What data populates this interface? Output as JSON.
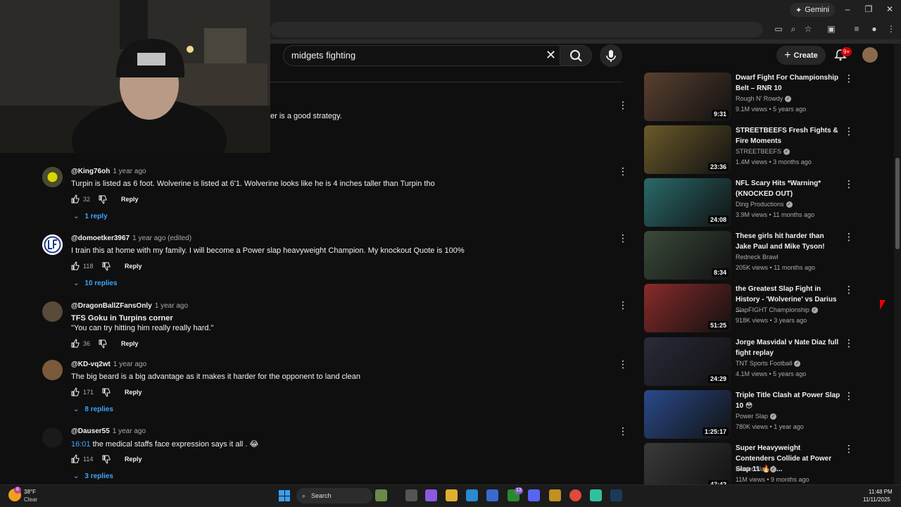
{
  "browser": {
    "gemini_label": "Gemini"
  },
  "search": {
    "query": "midgets fighting"
  },
  "header": {
    "create_label": "Create",
    "notification_count": "9+"
  },
  "partial_comment": {
    "text_fragment": "er is a good strategy."
  },
  "comments": [
    {
      "author": "@King76oh",
      "time": "1 year ago",
      "text": "Turpin is listed as 6 foot. Wolverine is listed at 6'1. Wolverine looks like he is 4 inches taller than Turpin tho",
      "likes": "32",
      "reply_label": "Reply",
      "replies": "1 reply"
    },
    {
      "author": "@domoetker3967",
      "time": "1 year ago (edited)",
      "text": "I train this at home with my family. I will become a Power slap heavyweight Champion. My knockout Quote is 100%",
      "likes": "118",
      "reply_label": "Reply",
      "replies": "10 replies"
    },
    {
      "author": "@DragonBallZFansOnly",
      "time": "1 year ago",
      "text_line1": "TFS Goku in Turpins corner",
      "text_line2": "\"You can try hitting him really really hard.\"",
      "likes": "36",
      "reply_label": "Reply"
    },
    {
      "author": "@KD-vq2wt",
      "time": "1 year ago",
      "text": "The big beard is a big advantage as it makes it harder for the opponent to land clean",
      "likes": "171",
      "reply_label": "Reply",
      "replies": "8 replies"
    },
    {
      "author": "@Dauser55",
      "time": "1 year ago",
      "timestamp": "16:01",
      "text": " the medical staffs face expression says it all . 😂",
      "likes": "114",
      "reply_label": "Reply",
      "replies": "3 replies"
    }
  ],
  "videos": [
    {
      "title": "Dwarf Fight For Championship Belt – RNR 10",
      "channel": "Rough N' Rowdy",
      "views": "9.1M views",
      "age": "5 years ago",
      "duration": "9:31",
      "color": "#5a4030"
    },
    {
      "title": "STREETBEEFS Fresh Fights & Fire Moments",
      "channel": "STREETBEEFS",
      "views": "1.4M views",
      "age": "3 months ago",
      "duration": "23:36",
      "color": "#6b5a2a"
    },
    {
      "title": "NFL Scary Hits *Warning* (KNOCKED OUT)",
      "channel": "Ding Productions",
      "views": "3.9M views",
      "age": "11 months ago",
      "duration": "24:08",
      "color": "#2a6a6a"
    },
    {
      "title": "These girls hit harder than Jake Paul and Mike Tyson!",
      "channel": "Redneck Brawl",
      "views": "205K views",
      "age": "11 months ago",
      "duration": "8:34",
      "color": "#3a4a3a"
    },
    {
      "title": "the Greatest Slap Fight in History - 'Wolverine' vs Darius ...",
      "channel": "SlapFIGHT Championship",
      "views": "918K views",
      "age": "3 years ago",
      "duration": "51:25",
      "color": "#8a2a2a"
    },
    {
      "title": "Jorge Masvidal v Nate Diaz full fight replay",
      "channel": "TNT Sports Football",
      "views": "4.1M views",
      "age": "5 years ago",
      "duration": "24:29",
      "color": "#2a2a3a"
    },
    {
      "title": "Triple Title Clash at Power Slap 10 😳",
      "channel": "Power Slap",
      "views": "780K views",
      "age": "1 year ago",
      "duration": "1:25:17",
      "color": "#2a4a8a"
    },
    {
      "title": "Super Heavyweight Contenders Collide at Power Slap 11 🔥 | ...",
      "channel": "Power Slap",
      "views": "11M views",
      "age": "9 months ago",
      "duration": "47:42",
      "color": "#3a3a3a"
    }
  ],
  "taskbar": {
    "temp": "38°F",
    "condition": "Clear",
    "weather_badge": "8",
    "search_label": "Search",
    "xbox_badge": "13",
    "time": "11:48 PM",
    "date": "11/11/2025"
  },
  "colors": {
    "background": "#0f0f0f",
    "link_blue": "#3ea6ff",
    "notif_red": "#cc0000"
  }
}
